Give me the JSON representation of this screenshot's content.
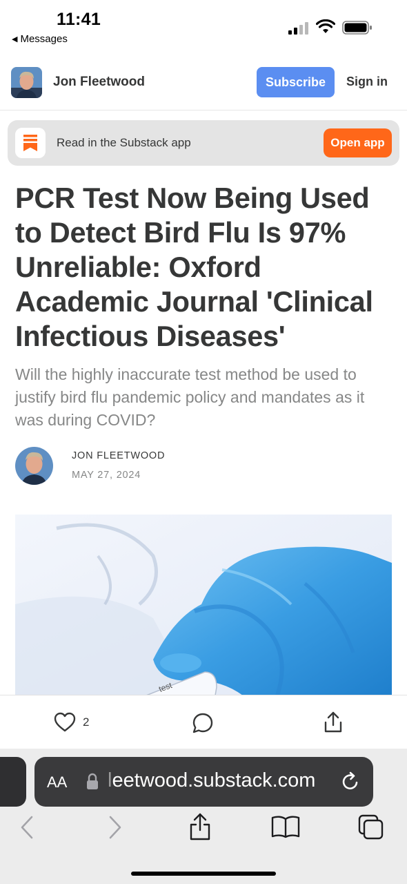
{
  "status_bar": {
    "time": "11:41",
    "back_label": "Messages"
  },
  "header": {
    "publication_name": "Jon Fleetwood",
    "subscribe_label": "Subscribe",
    "signin_label": "Sign in"
  },
  "app_banner": {
    "text": "Read in the Substack app",
    "button_label": "Open app"
  },
  "article": {
    "title": "PCR Test Now Being Used to Detect Bird Flu Is 97% Unreliable: Oxford Academic Journal 'Clinical Infectious Diseases'",
    "subtitle": "Will the highly inaccurate test method be used to justify bird flu pandemic policy and mandates as it was during COVID?",
    "author": "JON FLEETWOOD",
    "date": "MAY 27, 2024",
    "hero_image_text": "test"
  },
  "actions": {
    "like_count": "2"
  },
  "browser": {
    "text_size_label": "AA",
    "url_cursor": "l",
    "url": "eetwood.substack.com"
  },
  "colors": {
    "subscribe": "#5b8ef1",
    "open_app": "#ff6719",
    "text_primary": "#363737",
    "text_secondary": "#868787"
  }
}
